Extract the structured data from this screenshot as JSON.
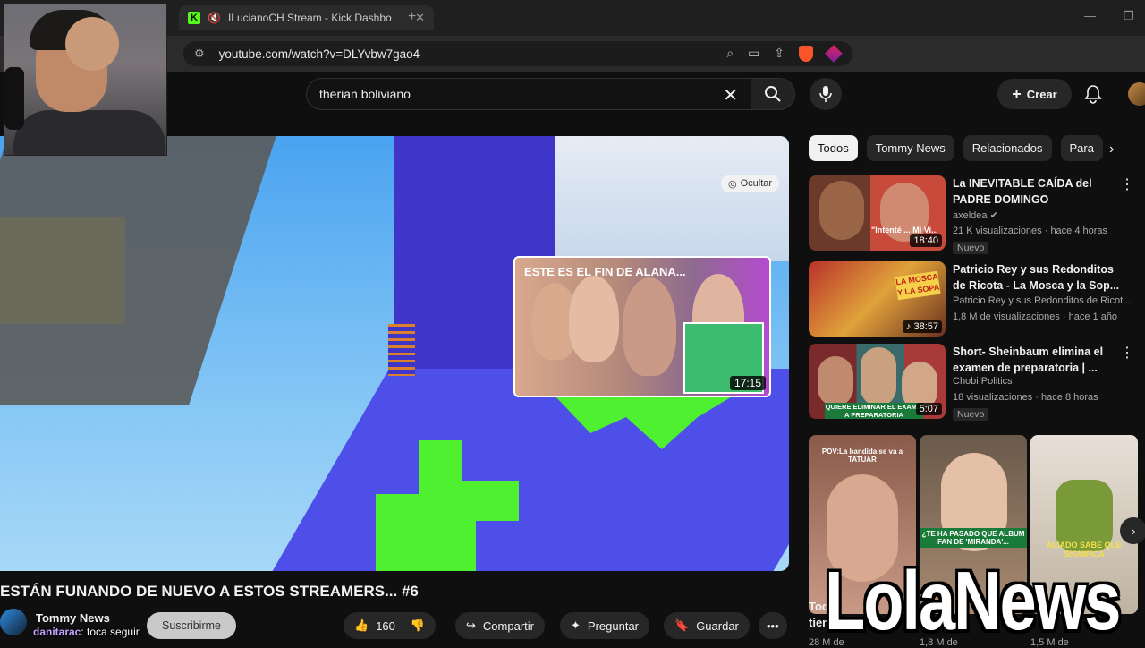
{
  "browser": {
    "tab_title": "ILucianoCH Stream - Kick Dashbo",
    "new_tab": "+",
    "url": "youtube.com/watch?v=DLYvbw7gao4",
    "notification_count": "1"
  },
  "header": {
    "search_value": "therian boliviano",
    "create_label": "Crear"
  },
  "video": {
    "hide_label": "Ocultar",
    "endcard_title": "ESTE ES EL FIN DE ALANA...",
    "endcard_duration": "17:15",
    "title": "ESTÁN FUNANDO DE NUEVO A ESTOS STREAMERS... #6",
    "channel": "Tommy News",
    "subscribe": "Suscribirme",
    "likes": "160",
    "share": "Compartir",
    "ask": "Preguntar",
    "save": "Guardar",
    "more": "•••"
  },
  "chat": {
    "user": "danitarac",
    "message": ": toca seguir"
  },
  "chips": [
    "Todos",
    "Tommy News",
    "Relacionados",
    "Para"
  ],
  "recommendations": [
    {
      "title": "La INEVITABLE CAÍDA del PADRE DOMINGO",
      "channel": "axeldea",
      "meta": "21 K visualizaciones · hace 4 horas",
      "badge": "Nuevo",
      "duration": "18:40",
      "thumb_text": "\"Intenté ... Mi Vi..."
    },
    {
      "title": "Patricio Rey y sus Redonditos de Ricota - La Mosca y la Sop...",
      "channel": "Patricio Rey y sus Redonditos de Ricot...",
      "meta": "1,8 M de visualizaciones · hace 1 año",
      "badge": "",
      "duration": "38:57",
      "thumb_text": "LA MOSCA Y LA SOPA"
    },
    {
      "title": "Short- Sheinbaum elimina el examen de preparatoria | ...",
      "channel": "Chobi Politics",
      "meta": "18 visualizaciones · hace 8 horas",
      "badge": "Nuevo",
      "duration": "5:07",
      "thumb_text": "QUIERE ELIMINAR EL EXAM... A PREPARATORIA"
    }
  ],
  "shorts": [
    {
      "caption": "POV:La bandida se va a TATUAR",
      "title": "Tod",
      "sub": "tienes a",
      "views": "28 M de"
    },
    {
      "caption": "¿TE HA PASADO QUE ALBUM FAN DE 'MIRANDA'...",
      "title": "",
      "sub": "",
      "views": "1,8 M de"
    },
    {
      "caption": "ALIADO SABE QUE SIGNIFICA",
      "title": "",
      "sub": "",
      "views": "1,5 M de"
    }
  ],
  "watermark": "LolaNews"
}
